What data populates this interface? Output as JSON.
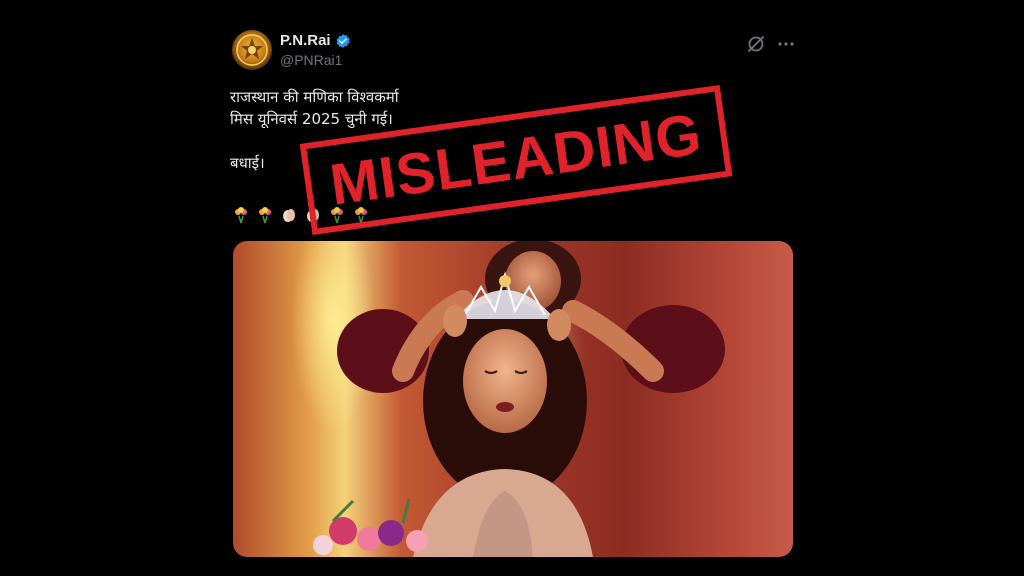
{
  "tweet": {
    "display_name": "P.N.Rai",
    "handle": "@PNRai1",
    "text_lines": [
      "राजस्थान की मणिका विश्वकर्मा",
      "मिस यूनिवर्स 2025 चुनी गई।"
    ],
    "text_line2": "बधाई।",
    "emojis": [
      "bouquet",
      "bouquet",
      "clapping-hands",
      "clapping-hands",
      "bouquet",
      "bouquet"
    ]
  },
  "overlay": {
    "stamp_label": "MISLEADING",
    "stamp_color": "#e0222a"
  },
  "colors": {
    "background": "#000000",
    "text_primary": "#e7e9ea",
    "text_secondary": "#71767b",
    "verified": "#1d9bf0"
  },
  "icons": {
    "verified": "verified-badge-icon",
    "grok": "grok-icon",
    "more": "more-horizontal-icon"
  }
}
